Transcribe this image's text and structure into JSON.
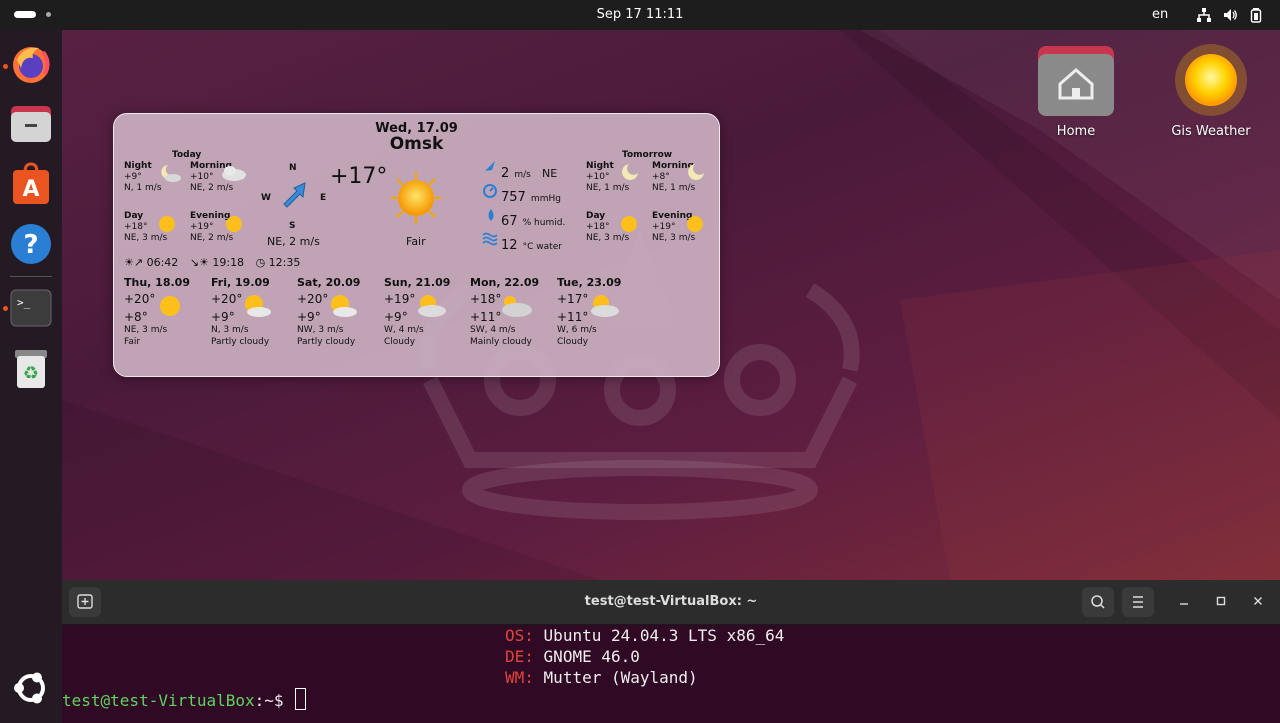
{
  "topbar": {
    "datetime": "Sep 17  11:11",
    "keyboard_layout": "en",
    "icons": [
      "network-icon",
      "volume-icon",
      "battery-icon"
    ]
  },
  "dock": {
    "items": [
      {
        "name": "firefox",
        "running": true
      },
      {
        "name": "files",
        "running": false
      },
      {
        "name": "app-center",
        "running": false
      },
      {
        "name": "help",
        "running": false
      },
      {
        "name": "terminal",
        "running": true
      },
      {
        "name": "trash",
        "running": false
      },
      {
        "name": "show-apps",
        "running": false
      }
    ]
  },
  "desktop": {
    "home_label": "Home",
    "gis_label": "Gis Weather"
  },
  "weather": {
    "date": "Wed, 17.09",
    "city": "Omsk",
    "today_label": "Today",
    "tomorrow_label": "Tomorrow",
    "today": {
      "night": {
        "label": "Night",
        "temp": "+9°",
        "wind": "N, 1 m/s"
      },
      "morning": {
        "label": "Morning",
        "temp": "+10°",
        "wind": "NE, 2 m/s"
      },
      "day": {
        "label": "Day",
        "temp": "+18°",
        "wind": "NE, 3 m/s"
      },
      "evening": {
        "label": "Evening",
        "temp": "+19°",
        "wind": "NE, 2 m/s"
      }
    },
    "tomorrow": {
      "night": {
        "label": "Night",
        "temp": "+10°",
        "wind": "NE, 1 m/s"
      },
      "morning": {
        "label": "Morning",
        "temp": "+8°",
        "wind": "NE, 1 m/s"
      },
      "day": {
        "label": "Day",
        "temp": "+18°",
        "wind": "NE, 3 m/s"
      },
      "evening": {
        "label": "Evening",
        "temp": "+19°",
        "wind": "NE, 3 m/s"
      }
    },
    "compass": {
      "n": "N",
      "s": "S",
      "w": "W",
      "e": "E",
      "wind": "NE, 2 m/s"
    },
    "current_temp": "+17°",
    "condition": "Fair",
    "details": {
      "wind_value": "2",
      "wind_unit": "m/s",
      "wind_dir": "NE",
      "pressure_value": "757",
      "pressure_unit": "mmHg",
      "humidity_value": "67",
      "humidity_unit": "% humid.",
      "water_value": "12",
      "water_unit": "°C water"
    },
    "sun": {
      "sunrise": "06:42",
      "sunset": "19:18",
      "daylength": "12:35"
    },
    "forecast": [
      {
        "day": "Thu, 18.09",
        "high": "+20°",
        "low": "+8°",
        "wind": "NE, 3 m/s",
        "desc": "Fair",
        "icon": "sun"
      },
      {
        "day": "Fri, 19.09",
        "high": "+20°",
        "low": "+9°",
        "wind": "N, 3 m/s",
        "desc": "Partly cloudy",
        "icon": "partly"
      },
      {
        "day": "Sat, 20.09",
        "high": "+20°",
        "low": "+9°",
        "wind": "NW, 3 m/s",
        "desc": "Partly cloudy",
        "icon": "partly"
      },
      {
        "day": "Sun, 21.09",
        "high": "+19°",
        "low": "+9°",
        "wind": "W, 4 m/s",
        "desc": "Cloudy",
        "icon": "cloudy-sun"
      },
      {
        "day": "Mon, 22.09",
        "high": "+18°",
        "low": "+11°",
        "wind": "SW, 4 m/s",
        "desc": "Mainly cloudy",
        "icon": "mainly-cloudy"
      },
      {
        "day": "Tue, 23.09",
        "high": "+17°",
        "low": "+11°",
        "wind": "W, 6 m/s",
        "desc": "Cloudy",
        "icon": "cloudy-sun"
      }
    ]
  },
  "terminal": {
    "title": "test@test-VirtualBox: ~",
    "lines": [
      {
        "label": "OS:",
        "value": "Ubuntu 24.04.3 LTS x86_64"
      },
      {
        "label": "DE:",
        "value": "GNOME 46.0"
      },
      {
        "label": "WM:",
        "value": "Mutter (Wayland)"
      }
    ],
    "prompt_user": "test@test-VirtualBox",
    "prompt_rest": ":~$ "
  }
}
